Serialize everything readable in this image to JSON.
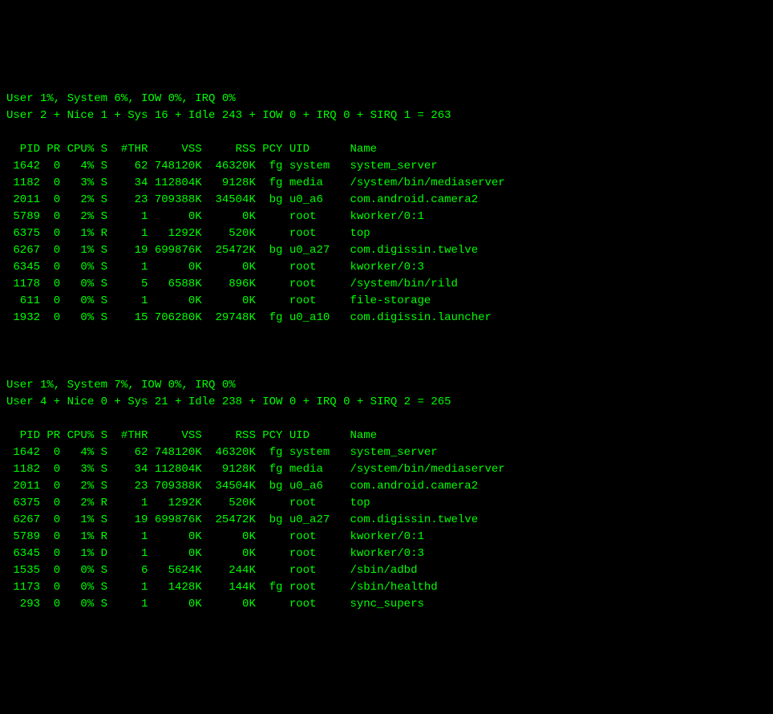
{
  "snapshots": [
    {
      "summary1": "User 1%, System 6%, IOW 0%, IRQ 0%",
      "summary2": "User 2 + Nice 1 + Sys 16 + Idle 243 + IOW 0 + IRQ 0 + SIRQ 1 = 263",
      "header": {
        "pid": "PID",
        "pr": "PR",
        "cpu": "CPU%",
        "s": "S",
        "thr": "#THR",
        "vss": "VSS",
        "rss": "RSS",
        "pcy": "PCY",
        "uid": "UID",
        "name": "Name"
      },
      "processes": [
        {
          "pid": "1642",
          "pr": "0",
          "cpu": "4%",
          "s": "S",
          "thr": "62",
          "vss": "748120K",
          "rss": "46320K",
          "pcy": "fg",
          "uid": "system",
          "name": "system_server"
        },
        {
          "pid": "1182",
          "pr": "0",
          "cpu": "3%",
          "s": "S",
          "thr": "34",
          "vss": "112804K",
          "rss": "9128K",
          "pcy": "fg",
          "uid": "media",
          "name": "/system/bin/mediaserver"
        },
        {
          "pid": "2011",
          "pr": "0",
          "cpu": "2%",
          "s": "S",
          "thr": "23",
          "vss": "709388K",
          "rss": "34504K",
          "pcy": "bg",
          "uid": "u0_a6",
          "name": "com.android.camera2"
        },
        {
          "pid": "5789",
          "pr": "0",
          "cpu": "2%",
          "s": "S",
          "thr": "1",
          "vss": "0K",
          "rss": "0K",
          "pcy": "",
          "uid": "root",
          "name": "kworker/0:1"
        },
        {
          "pid": "6375",
          "pr": "0",
          "cpu": "1%",
          "s": "R",
          "thr": "1",
          "vss": "1292K",
          "rss": "520K",
          "pcy": "",
          "uid": "root",
          "name": "top"
        },
        {
          "pid": "6267",
          "pr": "0",
          "cpu": "1%",
          "s": "S",
          "thr": "19",
          "vss": "699876K",
          "rss": "25472K",
          "pcy": "bg",
          "uid": "u0_a27",
          "name": "com.digissin.twelve"
        },
        {
          "pid": "6345",
          "pr": "0",
          "cpu": "0%",
          "s": "S",
          "thr": "1",
          "vss": "0K",
          "rss": "0K",
          "pcy": "",
          "uid": "root",
          "name": "kworker/0:3"
        },
        {
          "pid": "1178",
          "pr": "0",
          "cpu": "0%",
          "s": "S",
          "thr": "5",
          "vss": "6588K",
          "rss": "896K",
          "pcy": "",
          "uid": "root",
          "name": "/system/bin/rild"
        },
        {
          "pid": "611",
          "pr": "0",
          "cpu": "0%",
          "s": "S",
          "thr": "1",
          "vss": "0K",
          "rss": "0K",
          "pcy": "",
          "uid": "root",
          "name": "file-storage"
        },
        {
          "pid": "1932",
          "pr": "0",
          "cpu": "0%",
          "s": "S",
          "thr": "15",
          "vss": "706280K",
          "rss": "29748K",
          "pcy": "fg",
          "uid": "u0_a10",
          "name": "com.digissin.launcher"
        }
      ]
    },
    {
      "summary1": "User 1%, System 7%, IOW 0%, IRQ 0%",
      "summary2": "User 4 + Nice 0 + Sys 21 + Idle 238 + IOW 0 + IRQ 0 + SIRQ 2 = 265",
      "header": {
        "pid": "PID",
        "pr": "PR",
        "cpu": "CPU%",
        "s": "S",
        "thr": "#THR",
        "vss": "VSS",
        "rss": "RSS",
        "pcy": "PCY",
        "uid": "UID",
        "name": "Name"
      },
      "processes": [
        {
          "pid": "1642",
          "pr": "0",
          "cpu": "4%",
          "s": "S",
          "thr": "62",
          "vss": "748120K",
          "rss": "46320K",
          "pcy": "fg",
          "uid": "system",
          "name": "system_server"
        },
        {
          "pid": "1182",
          "pr": "0",
          "cpu": "3%",
          "s": "S",
          "thr": "34",
          "vss": "112804K",
          "rss": "9128K",
          "pcy": "fg",
          "uid": "media",
          "name": "/system/bin/mediaserver"
        },
        {
          "pid": "2011",
          "pr": "0",
          "cpu": "2%",
          "s": "S",
          "thr": "23",
          "vss": "709388K",
          "rss": "34504K",
          "pcy": "bg",
          "uid": "u0_a6",
          "name": "com.android.camera2"
        },
        {
          "pid": "6375",
          "pr": "0",
          "cpu": "2%",
          "s": "R",
          "thr": "1",
          "vss": "1292K",
          "rss": "520K",
          "pcy": "",
          "uid": "root",
          "name": "top"
        },
        {
          "pid": "6267",
          "pr": "0",
          "cpu": "1%",
          "s": "S",
          "thr": "19",
          "vss": "699876K",
          "rss": "25472K",
          "pcy": "bg",
          "uid": "u0_a27",
          "name": "com.digissin.twelve"
        },
        {
          "pid": "5789",
          "pr": "0",
          "cpu": "1%",
          "s": "R",
          "thr": "1",
          "vss": "0K",
          "rss": "0K",
          "pcy": "",
          "uid": "root",
          "name": "kworker/0:1"
        },
        {
          "pid": "6345",
          "pr": "0",
          "cpu": "1%",
          "s": "D",
          "thr": "1",
          "vss": "0K",
          "rss": "0K",
          "pcy": "",
          "uid": "root",
          "name": "kworker/0:3"
        },
        {
          "pid": "1535",
          "pr": "0",
          "cpu": "0%",
          "s": "S",
          "thr": "6",
          "vss": "5624K",
          "rss": "244K",
          "pcy": "",
          "uid": "root",
          "name": "/sbin/adbd"
        },
        {
          "pid": "1173",
          "pr": "0",
          "cpu": "0%",
          "s": "S",
          "thr": "1",
          "vss": "1428K",
          "rss": "144K",
          "pcy": "fg",
          "uid": "root",
          "name": "/sbin/healthd"
        },
        {
          "pid": "293",
          "pr": "0",
          "cpu": "0%",
          "s": "S",
          "thr": "1",
          "vss": "0K",
          "rss": "0K",
          "pcy": "",
          "uid": "root",
          "name": "sync_supers"
        }
      ]
    }
  ]
}
